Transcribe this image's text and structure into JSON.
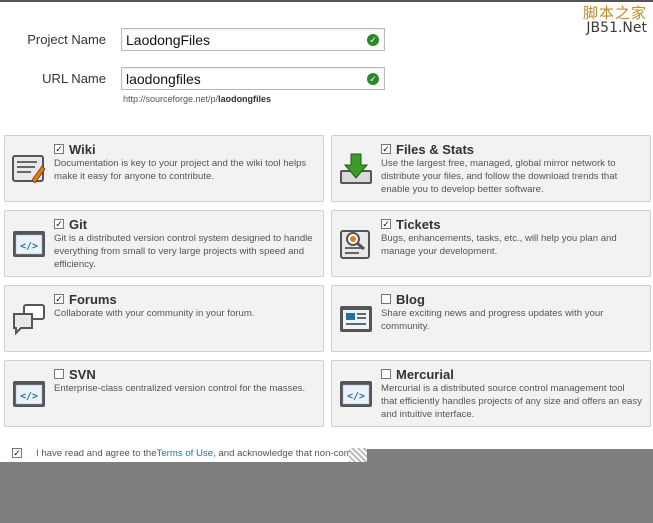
{
  "watermark": {
    "top": "脚本之家",
    "bottom": "JB51.Net"
  },
  "form": {
    "project_label": "Project Name",
    "project_value": "LaodongFiles",
    "url_label": "URL Name",
    "url_value": "laodongfiles",
    "url_hint_prefix": "http://sourceforge.net/p/",
    "url_hint_name": "laodongfiles"
  },
  "tools": [
    {
      "name": "Wiki",
      "checked": true,
      "icon": "wiki-icon",
      "desc": "Documentation is key to your project and the wiki tool helps make it easy for anyone to contribute."
    },
    {
      "name": "Files & Stats",
      "checked": true,
      "icon": "download-icon",
      "desc": "Use the largest free, managed, global mirror network to distribute your files, and follow the download trends that enable you to develop better software."
    },
    {
      "name": "Git",
      "checked": true,
      "icon": "code-icon",
      "desc": "Git is a distributed version control system designed to handle everything from small to very large projects with speed and efficiency."
    },
    {
      "name": "Tickets",
      "checked": true,
      "icon": "tickets-icon",
      "desc": "Bugs, enhancements, tasks, etc., will help you plan and manage your development."
    },
    {
      "name": "Forums",
      "checked": true,
      "icon": "forums-icon",
      "desc": "Collaborate with your community in your forum."
    },
    {
      "name": "Blog",
      "checked": false,
      "icon": "blog-icon",
      "desc": "Share exciting news and progress updates with your community."
    },
    {
      "name": "SVN",
      "checked": false,
      "icon": "code-icon",
      "desc": "Enterprise-class centralized version control for the masses."
    },
    {
      "name": "Mercurial",
      "checked": false,
      "icon": "code-icon",
      "desc": "Mercurial is a distributed source control management tool that efficiently handles projects of any size and offers an easy and intuitive interface."
    }
  ],
  "agree": {
    "checked": true,
    "text_before": "I have read and agree to the ",
    "link": "Terms of Use",
    "text_after": ", and acknowledge that non-complia"
  },
  "colors": {
    "check_ok": "#2a8a2a",
    "link": "#2a6ea0",
    "panel_bg": "#f2f2f2",
    "cover_grey": "#7e7e7e"
  }
}
